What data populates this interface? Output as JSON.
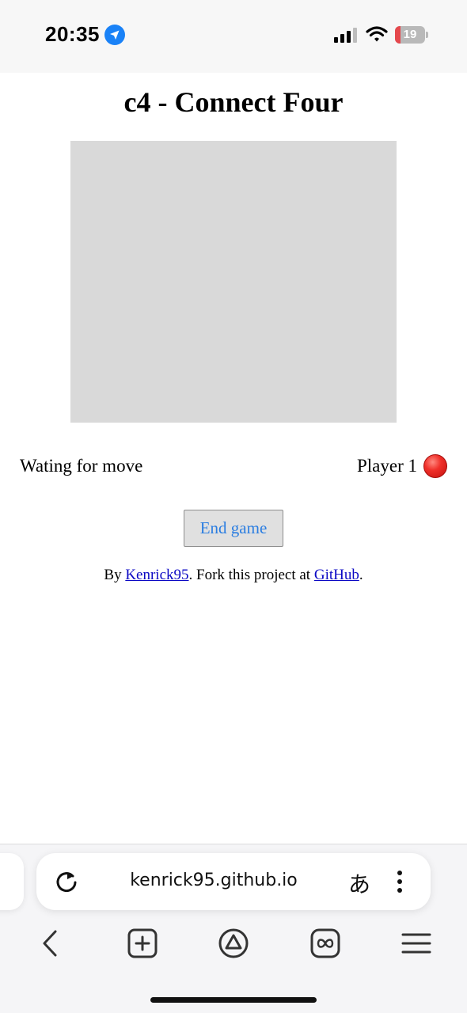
{
  "status_bar": {
    "time": "20:35",
    "battery_level": "19",
    "battery_fraction": 0.19,
    "icons": [
      "location-arrow-icon",
      "cellular-signal-icon",
      "wifi-icon",
      "battery-icon"
    ]
  },
  "page": {
    "title": "c4 - Connect Four",
    "status": "Wating for move",
    "player": "Player 1",
    "player_token_color": "#e5221d",
    "end_game_label": "End game",
    "footer": {
      "prefix": "By ",
      "author_link": "Kenrick95",
      "middle": ". Fork this project at ",
      "repo_link": "GitHub",
      "suffix": "."
    }
  },
  "browser": {
    "url": "kenrick95.github.io",
    "translate_glyph": "あ",
    "nav_icons": [
      "back-icon",
      "new-tab-icon",
      "home-icon",
      "tabs-icon",
      "menu-icon"
    ]
  },
  "colors": {
    "board": "#d9d9d9",
    "link": "#0b08c4",
    "button_text": "#2a7de1",
    "location_accent": "#1a82f7"
  }
}
